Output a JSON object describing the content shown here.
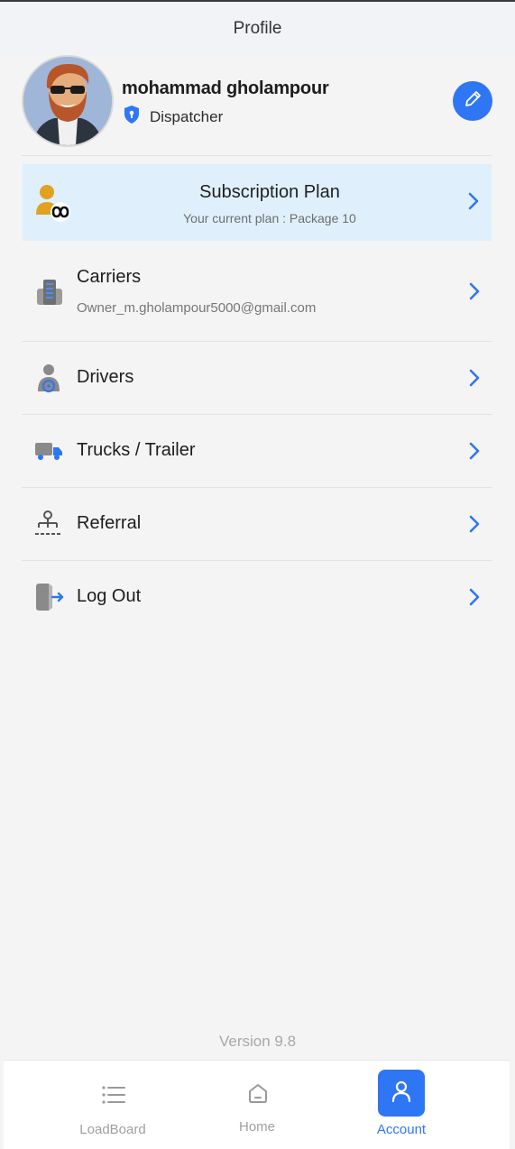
{
  "header": {
    "title": "Profile"
  },
  "profile": {
    "name": "mohammad gholampour",
    "role": "Dispatcher"
  },
  "subscription": {
    "title": "Subscription Plan",
    "description": "Your current plan : Package 10"
  },
  "menu": {
    "carriers": {
      "label": "Carriers",
      "sub": "Owner_m.gholampour5000@gmail.com"
    },
    "drivers": {
      "label": "Drivers"
    },
    "trucks": {
      "label": "Trucks / Trailer"
    },
    "referral": {
      "label": "Referral"
    },
    "logout": {
      "label": "Log Out"
    }
  },
  "version": "Version 9.8",
  "bottom_nav": {
    "items": [
      {
        "label": "LoadBoard",
        "icon": "list-icon",
        "active": false
      },
      {
        "label": "Home",
        "icon": "home-icon",
        "active": false
      },
      {
        "label": "Account",
        "icon": "user-icon",
        "active": true
      }
    ]
  },
  "colors": {
    "accent": "#2f76f5",
    "subscription_bg": "#dff0fc",
    "page_bg": "#f4f4f4"
  }
}
